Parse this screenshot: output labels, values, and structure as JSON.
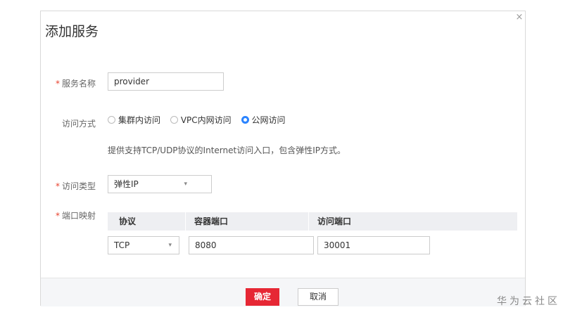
{
  "dialog": {
    "title": "添加服务",
    "close_icon": "×"
  },
  "form": {
    "service_name": {
      "required_mark": "*",
      "label": "服务名称",
      "value": "provider"
    },
    "access_mode": {
      "label": "访问方式",
      "options": [
        "集群内访问",
        "VPC内网访问",
        "公网访问"
      ],
      "selected": "公网访问",
      "hint": "提供支持TCP/UDP协议的Internet访问入口，包含弹性IP方式。"
    },
    "access_type": {
      "required_mark": "*",
      "label": "访问类型",
      "value": "弹性IP",
      "caret": "▾"
    },
    "port_mapping": {
      "required_mark": "*",
      "label": "端口映射",
      "columns": [
        "协议",
        "容器端口",
        "访问端口"
      ],
      "row": {
        "protocol": "TCP",
        "protocol_caret": "▾",
        "container_port": "8080",
        "access_port": "30001"
      }
    }
  },
  "footer": {
    "ok_label": "确定",
    "cancel_label": "取消"
  },
  "watermark": "华为云社区",
  "colors": {
    "accent_red": "#e62734",
    "radio_blue": "#2b84ff",
    "required": "#e8402c"
  }
}
